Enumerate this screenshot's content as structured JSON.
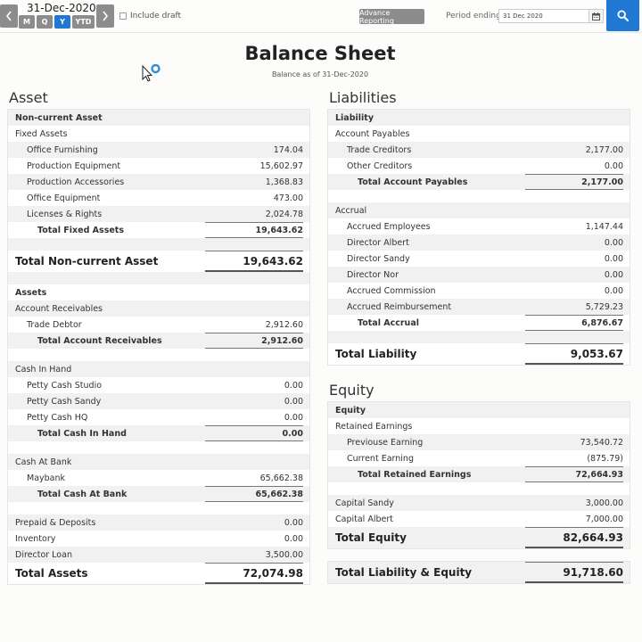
{
  "toolbar": {
    "date_title": "31-Dec-2020",
    "periods": [
      "M",
      "Q",
      "Y",
      "YTD"
    ],
    "active_period": "Y",
    "include_draft_label": "Include draft",
    "advanced_reporting_label": "Advance Reporting",
    "period_ending_label": "Period ending:",
    "period_ending_value": "31 Dec 2020"
  },
  "colors": {
    "accent": "#1f78d1",
    "button_gray": "#8c8c8c",
    "row_stripe": "#f1f1f1"
  },
  "header": {
    "title": "Balance Sheet",
    "subtitle": "Balance as of 31-Dec-2020"
  },
  "asset": {
    "heading": "Asset",
    "rows": [
      {
        "label": "Non-current Asset",
        "amount": "",
        "level": 1,
        "bold": true
      },
      {
        "label": "Fixed Assets",
        "amount": "",
        "level": 1
      },
      {
        "label": "Office Furnishing",
        "amount": "174.04",
        "level": 2
      },
      {
        "label": "Production Equipment",
        "amount": "15,602.97",
        "level": 2
      },
      {
        "label": "Production Accessories",
        "amount": "1,368.83",
        "level": 2
      },
      {
        "label": "Office Equipment",
        "amount": "473.00",
        "level": 2
      },
      {
        "label": "Licenses & Rights",
        "amount": "2,024.78",
        "level": 2
      },
      {
        "label": "Total Fixed Assets",
        "amount": "19,643.62",
        "level": 3,
        "bold": true,
        "subtotal": true
      },
      {
        "gap": true
      },
      {
        "label": "Total Non-current Asset",
        "amount": "19,643.62",
        "level": 1,
        "big": true
      },
      {
        "gap": true
      },
      {
        "label": "Assets",
        "amount": "",
        "level": 1,
        "bold": true
      },
      {
        "label": "Account Receivables",
        "amount": "",
        "level": 1
      },
      {
        "label": "Trade Debtor",
        "amount": "2,912.60",
        "level": 2
      },
      {
        "label": "Total Account Receivables",
        "amount": "2,912.60",
        "level": 3,
        "bold": true,
        "subtotal": true
      },
      {
        "gap": true
      },
      {
        "label": "Cash In Hand",
        "amount": "",
        "level": 1
      },
      {
        "label": "Petty Cash Studio",
        "amount": "0.00",
        "level": 2
      },
      {
        "label": "Petty Cash Sandy",
        "amount": "0.00",
        "level": 2
      },
      {
        "label": "Petty Cash HQ",
        "amount": "0.00",
        "level": 2
      },
      {
        "label": "Total Cash In Hand",
        "amount": "0.00",
        "level": 3,
        "bold": true,
        "subtotal": true
      },
      {
        "gap": true
      },
      {
        "label": "Cash At Bank",
        "amount": "",
        "level": 1
      },
      {
        "label": "Maybank",
        "amount": "65,662.38",
        "level": 2
      },
      {
        "label": "Total Cash At Bank",
        "amount": "65,662.38",
        "level": 3,
        "bold": true,
        "subtotal": true
      },
      {
        "gap": true
      },
      {
        "label": "Prepaid & Deposits",
        "amount": "0.00",
        "level": 1
      },
      {
        "label": "Inventory",
        "amount": "0.00",
        "level": 1
      },
      {
        "label": "Director Loan",
        "amount": "3,500.00",
        "level": 1
      },
      {
        "label": "Total Assets",
        "amount": "72,074.98",
        "level": 1,
        "big": true
      }
    ]
  },
  "liabilities": {
    "heading": "Liabilities",
    "rows": [
      {
        "label": "Liability",
        "amount": "",
        "level": 1,
        "bold": true
      },
      {
        "label": "Account Payables",
        "amount": "",
        "level": 1
      },
      {
        "label": "Trade Creditors",
        "amount": "2,177.00",
        "level": 2
      },
      {
        "label": "Other Creditors",
        "amount": "0.00",
        "level": 2
      },
      {
        "label": "Total Account Payables",
        "amount": "2,177.00",
        "level": 3,
        "bold": true,
        "subtotal": true
      },
      {
        "gap": true
      },
      {
        "label": "Accrual",
        "amount": "",
        "level": 1
      },
      {
        "label": "Accrued Employees",
        "amount": "1,147.44",
        "level": 2
      },
      {
        "label": "Director Albert",
        "amount": "0.00",
        "level": 2
      },
      {
        "label": "Director Sandy",
        "amount": "0.00",
        "level": 2
      },
      {
        "label": "Director Nor",
        "amount": "0.00",
        "level": 2
      },
      {
        "label": "Accrued Commission",
        "amount": "0.00",
        "level": 2
      },
      {
        "label": "Accrued Reimbursement",
        "amount": "5,729.23",
        "level": 2
      },
      {
        "label": "Total Accrual",
        "amount": "6,876.67",
        "level": 3,
        "bold": true,
        "subtotal": true
      },
      {
        "gap": true
      },
      {
        "label": "Total Liability",
        "amount": "9,053.67",
        "level": 1,
        "big": true
      }
    ]
  },
  "equity": {
    "heading": "Equity",
    "rows": [
      {
        "label": "Equity",
        "amount": "",
        "level": 1,
        "bold": true
      },
      {
        "label": "Retained Earnings",
        "amount": "",
        "level": 1
      },
      {
        "label": "Previouse Earning",
        "amount": "73,540.72",
        "level": 2
      },
      {
        "label": "Current Earning",
        "amount": "(875.79)",
        "level": 2
      },
      {
        "label": "Total Retained Earnings",
        "amount": "72,664.93",
        "level": 3,
        "bold": true,
        "subtotal": true
      },
      {
        "gap": true
      },
      {
        "label": "Capital Sandy",
        "amount": "3,000.00",
        "level": 1
      },
      {
        "label": "Capital Albert",
        "amount": "7,000.00",
        "level": 1
      },
      {
        "label": "Total Equity",
        "amount": "82,664.93",
        "level": 1,
        "big": true
      }
    ]
  },
  "grand_total": {
    "label": "Total Liability & Equity",
    "amount": "91,718.60"
  }
}
